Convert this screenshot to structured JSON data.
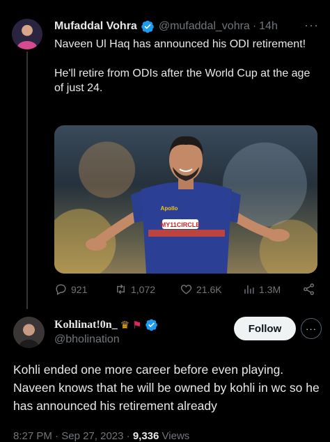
{
  "tweet": {
    "author_name": "Mufaddal Vohra",
    "author_handle": "@mufaddal_vohra",
    "separator": "·",
    "time_ago": "14h",
    "more_label": "···",
    "text_line1": "Naveen Ul Haq has announced his ODI retirement!",
    "text_line2": "He'll retire from ODIs after the World Cup at the age of just 24.",
    "jersey_text": "MY11CIRCLE",
    "jersey_sponsor": "Apollo",
    "stats": {
      "replies": "921",
      "retweets": "1,072",
      "likes": "21.6K",
      "views": "1.3M"
    }
  },
  "reply": {
    "author_name": "Kohlinat!0n_",
    "author_handle": "@bholination",
    "follow_label": "Follow",
    "more_label": "···",
    "text": "Kohli ended one more career before even playing. Naveen knows that he will be owned by kohli in wc so he has announced his retirement already",
    "time": "8:27 PM",
    "date": "Sep 27, 2023",
    "separator": "·",
    "views_count": "9,336",
    "views_label": "Views"
  },
  "colors": {
    "background": "#000000",
    "text": "#e7e9ea",
    "muted": "#71767b",
    "verified": "#1d9bf0"
  }
}
